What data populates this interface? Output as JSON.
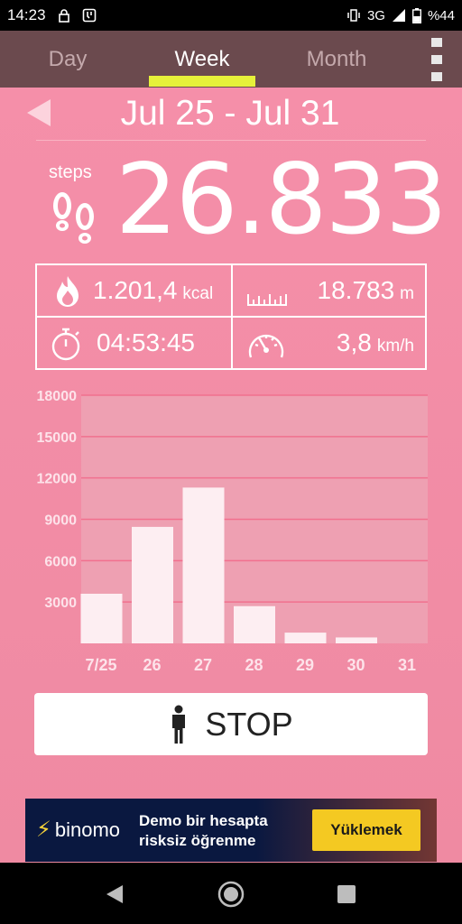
{
  "status_bar": {
    "time": "14:23",
    "network": "3G",
    "battery": "%44"
  },
  "tabs": {
    "day": "Day",
    "week": "Week",
    "month": "Month",
    "active": "week"
  },
  "header": {
    "date_range": "Jul 25 - Jul 31"
  },
  "steps": {
    "label": "steps",
    "value": "26.833"
  },
  "stats": {
    "calories": {
      "value": "1.201,4",
      "unit": "kcal",
      "icon": "flame-icon"
    },
    "distance": {
      "value": "18.783",
      "unit": "m",
      "icon": "ruler-icon"
    },
    "duration": {
      "value": "04:53:45",
      "icon": "stopwatch-icon"
    },
    "speed": {
      "value": "3,8",
      "unit": "km/h",
      "icon": "speedometer-icon"
    }
  },
  "chart_data": {
    "type": "bar",
    "categories": [
      "7/25",
      "26",
      "27",
      "28",
      "29",
      "30",
      "31"
    ],
    "values": [
      3600,
      8450,
      11300,
      2700,
      780,
      430,
      0
    ],
    "yticks": [
      3000,
      6000,
      9000,
      12000,
      15000,
      18000
    ],
    "ylim": [
      0,
      18000
    ],
    "grid": true,
    "colors": {
      "bar": "#fdeef2",
      "plot_bg": "#eea0b2",
      "grid": "#f1708e",
      "tick_label": "#fde3ea"
    }
  },
  "stop_button": {
    "label": "STOP"
  },
  "ad": {
    "brand": "binomo",
    "headline_line1": "Demo bir hesapta",
    "headline_line2": "risksiz öğrenme",
    "cta": "Yüklemek"
  },
  "colors": {
    "tab_bar": "#6b4a4e",
    "tab_underline": "#e6f13a",
    "panel": "#f58fa9"
  }
}
